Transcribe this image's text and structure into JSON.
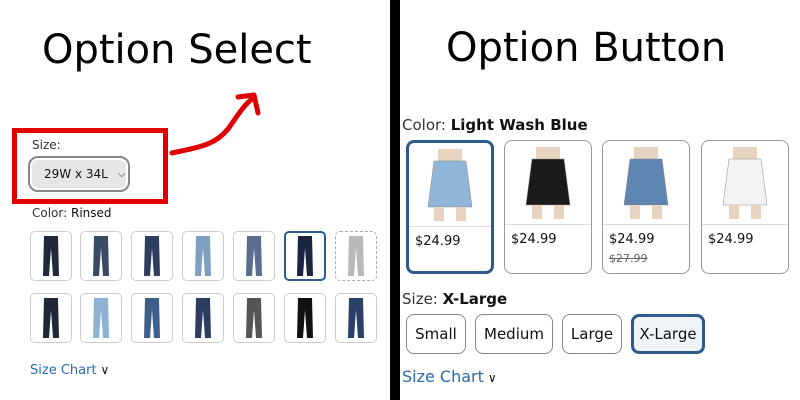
{
  "left_panel": {
    "title": "Option Select",
    "size_label": "Size:",
    "size_select_value": "29W x 34L",
    "color_label_prefix": "Color:",
    "color_value": "Rinsed",
    "size_chart": "Size Chart",
    "swatches": [
      {
        "color": "#20283a",
        "state": "normal"
      },
      {
        "color": "#3a4a66",
        "state": "normal"
      },
      {
        "color": "#2e3e5e",
        "state": "normal"
      },
      {
        "color": "#7ea0c0",
        "state": "normal"
      },
      {
        "color": "#5a6f8f",
        "state": "normal"
      },
      {
        "color": "#1c2540",
        "state": "selected"
      },
      {
        "color": "#b9b9b9",
        "state": "unavailable"
      },
      {
        "color": "#1e2638",
        "state": "normal"
      },
      {
        "color": "#8eb2d2",
        "state": "normal"
      },
      {
        "color": "#3e5f8a",
        "state": "normal"
      },
      {
        "color": "#2c3d60",
        "state": "normal"
      },
      {
        "color": "#555555",
        "state": "normal"
      },
      {
        "color": "#111111",
        "state": "normal"
      },
      {
        "color": "#2a4068",
        "state": "normal"
      }
    ]
  },
  "right_panel": {
    "title": "Option Button",
    "color_label_prefix": "Color:",
    "color_value": "Light Wash Blue",
    "products": [
      {
        "price": "$24.99",
        "old_price": "",
        "color": "#8fb6d8",
        "selected": true
      },
      {
        "price": "$24.99",
        "old_price": "",
        "color": "#1a1a1a",
        "selected": false
      },
      {
        "price": "$24.99",
        "old_price": "$27.99",
        "color": "#5f86b0",
        "selected": false
      },
      {
        "price": "$24.99",
        "old_price": "",
        "color": "#f3f3f3",
        "selected": false
      }
    ],
    "size_label_prefix": "Size:",
    "size_value": "X-Large",
    "sizes": [
      {
        "label": "Small",
        "selected": false
      },
      {
        "label": "Medium",
        "selected": false
      },
      {
        "label": "Large",
        "selected": false
      },
      {
        "label": "X-Large",
        "selected": true
      }
    ],
    "size_chart": "Size Chart"
  },
  "colors": {
    "highlight_red": "#e00000",
    "selected_border": "#2f5b8c",
    "link_blue": "#2a6aa8"
  }
}
